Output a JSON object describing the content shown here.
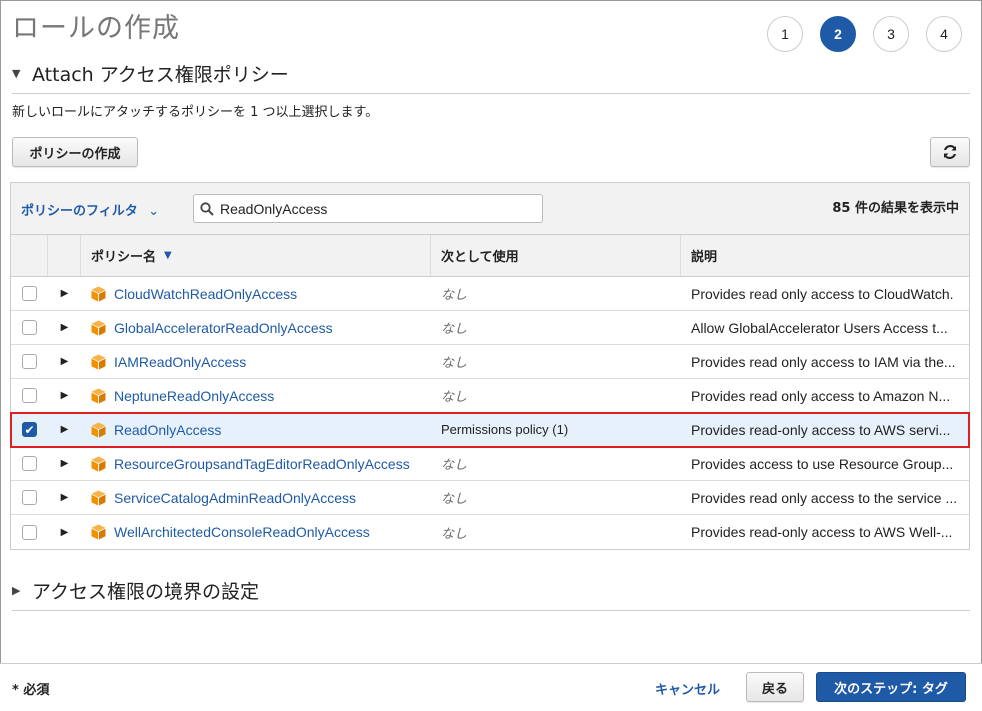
{
  "page": {
    "title": "ロールの作成"
  },
  "steps": [
    "1",
    "2",
    "3",
    "4"
  ],
  "active_step": "2",
  "attach_section": {
    "title": "Attach アクセス権限ポリシー",
    "description": "新しいロールにアタッチするポリシーを 1 つ以上選択します。",
    "create_policy_label": "ポリシーの作成"
  },
  "filter": {
    "label": "ポリシーのフィルタ",
    "search_value": "ReadOnlyAccess",
    "result_count": "85 件の結果を表示中"
  },
  "table": {
    "headers": {
      "name": "ポリシー名",
      "used_as": "次として使用",
      "description": "説明"
    },
    "rows": [
      {
        "name": "CloudWatchReadOnlyAccess",
        "used_as": "なし",
        "description": "Provides read only access to CloudWatch.",
        "checked": false
      },
      {
        "name": "GlobalAcceleratorReadOnlyAccess",
        "used_as": "なし",
        "description": "Allow GlobalAccelerator Users Access t...",
        "checked": false
      },
      {
        "name": "IAMReadOnlyAccess",
        "used_as": "なし",
        "description": "Provides read only access to IAM via the...",
        "checked": false
      },
      {
        "name": "NeptuneReadOnlyAccess",
        "used_as": "なし",
        "description": "Provides read only access to Amazon N...",
        "checked": false
      },
      {
        "name": "ReadOnlyAccess",
        "used_as": "Permissions policy (1)",
        "description": "Provides read-only access to AWS servi...",
        "checked": true
      },
      {
        "name": "ResourceGroupsandTagEditorReadOnlyAccess",
        "used_as": "なし",
        "description": "Provides access to use Resource Group...",
        "checked": false
      },
      {
        "name": "ServiceCatalogAdminReadOnlyAccess",
        "used_as": "なし",
        "description": "Provides read only access to the service ...",
        "checked": false
      },
      {
        "name": "WellArchitectedConsoleReadOnlyAccess",
        "used_as": "なし",
        "description": "Provides read-only access to AWS Well-...",
        "checked": false
      }
    ]
  },
  "boundary_section": {
    "title": "アクセス権限の境界の設定"
  },
  "footer": {
    "required_label": "* 必須",
    "cancel_label": "キャンセル",
    "back_label": "戻る",
    "next_label": "次のステップ: タグ"
  },
  "colors": {
    "accent": "#1f5aa6",
    "highlight_border": "#e02020",
    "policy_icon": "#f29100"
  },
  "icons": {
    "refresh": "refresh-icon",
    "search": "search-icon",
    "policy": "policy-cube-icon"
  }
}
